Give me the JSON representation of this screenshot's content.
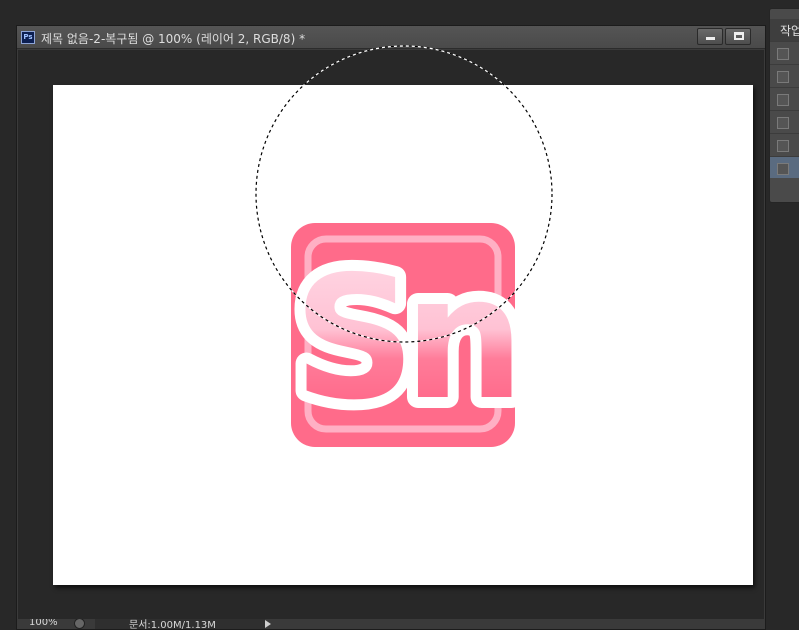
{
  "window": {
    "app_icon": "Ps",
    "title": "제목 없음-2-복구됨 @ 100% (레이어 2, RGB/8) *",
    "buttons": [
      "minimize",
      "maximize"
    ]
  },
  "status": {
    "zoom": "100%",
    "doc_info": "문서:1.00M/1.13M"
  },
  "panel": {
    "header": "작업"
  },
  "logo": {
    "text": "Sn",
    "colors": {
      "tile": "#ff6b8a",
      "tile_inner": "#ff5f82",
      "border": "#ffb0c4",
      "letters_top": "#ffd4e2"
    }
  },
  "selection": {
    "shape": "circle",
    "style": "marching-ants"
  },
  "colors": {
    "workspace": "#282828",
    "canvas": "#ffffff",
    "titlebar": "#4e4e4e"
  }
}
